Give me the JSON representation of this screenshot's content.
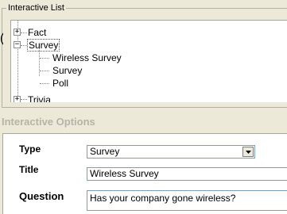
{
  "list_group": {
    "label": "Interactive List",
    "tree": [
      {
        "label": "Fact",
        "expander": "+"
      },
      {
        "label": "Survey",
        "expander": "−",
        "selected": true,
        "children": [
          {
            "label": "Wireless Survey"
          },
          {
            "label": "Survey"
          },
          {
            "label": "Poll"
          }
        ]
      },
      {
        "label": "Trivia",
        "expander": "+"
      }
    ]
  },
  "options": {
    "header": "Interactive Options",
    "type_label": "Type",
    "type_value": "Survey",
    "title_label": "Title",
    "title_value": "Wireless Survey",
    "question_label": "Question",
    "question_value": "Has your company gone wireless?"
  }
}
